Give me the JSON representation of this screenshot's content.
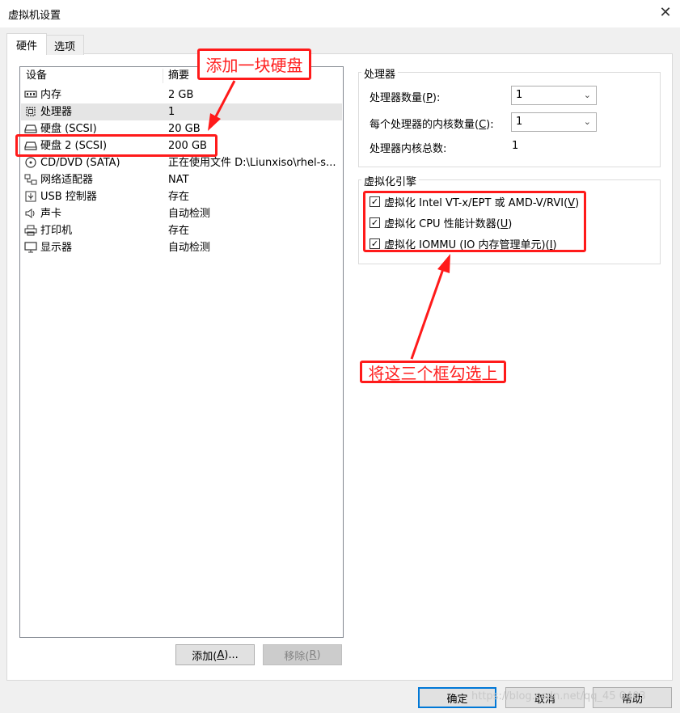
{
  "window": {
    "title": "虚拟机设置",
    "close_icon": "close-icon"
  },
  "tabs": [
    {
      "label": "硬件"
    },
    {
      "label": "选项"
    }
  ],
  "device_list": {
    "col_device": "设备",
    "col_summary": "摘要",
    "rows": [
      {
        "icon": "memory-icon",
        "name": "内存",
        "summary": "2 GB"
      },
      {
        "icon": "cpu-icon",
        "name": "处理器",
        "summary": "1"
      },
      {
        "icon": "hard-disk-icon",
        "name": "硬盘 (SCSI)",
        "summary": "20 GB"
      },
      {
        "icon": "hard-disk-icon",
        "name": "硬盘 2 (SCSI)",
        "summary": "200 GB"
      },
      {
        "icon": "cd-dvd-icon",
        "name": "CD/DVD (SATA)",
        "summary": "正在使用文件 D:\\Liunxiso\\rhel-s..."
      },
      {
        "icon": "network-adapter-icon",
        "name": "网络适配器",
        "summary": "NAT"
      },
      {
        "icon": "usb-icon",
        "name": "USB 控制器",
        "summary": "存在"
      },
      {
        "icon": "speaker-icon",
        "name": "声卡",
        "summary": "自动检测"
      },
      {
        "icon": "printer-icon",
        "name": "打印机",
        "summary": "存在"
      },
      {
        "icon": "monitor-icon",
        "name": "显示器",
        "summary": "自动检测"
      }
    ]
  },
  "buttons": {
    "add_pre": "添加(",
    "add_key": "A",
    "add_post": ")...",
    "remove_pre": "移除(",
    "remove_key": "R",
    "remove_post": ")"
  },
  "processor_group": {
    "title": "处理器",
    "count_label_pre": "处理器数量(",
    "count_key": "P",
    "count_label_post": "):",
    "count_value": "1",
    "cores_label_pre": "每个处理器的内核数量(",
    "cores_key": "C",
    "cores_label_post": "):",
    "cores_value": "1",
    "total_label": "处理器内核总数:",
    "total_value": "1"
  },
  "virt_group": {
    "title": "虚拟化引擎",
    "options": [
      {
        "pre": "虚拟化 Intel VT-x/EPT 或 AMD-V/RVI(",
        "key": "V",
        "post": ")",
        "checked": true
      },
      {
        "pre": "虚拟化 CPU 性能计数器(",
        "key": "U",
        "post": ")",
        "checked": true
      },
      {
        "pre": "虚拟化 IOMMU (IO 内存管理单元)(",
        "key": "I",
        "post": ")",
        "checked": true
      }
    ]
  },
  "annotations": {
    "add_disk": "添加一块硬盘",
    "check_boxes": "将这三个框勾选上",
    "color": "#ff1a1a"
  },
  "footer": {
    "ok": "确定",
    "cancel": "取消",
    "help_pre": "帮助",
    "watermark": "https://blog.csdn.net/qq_45 0403"
  }
}
